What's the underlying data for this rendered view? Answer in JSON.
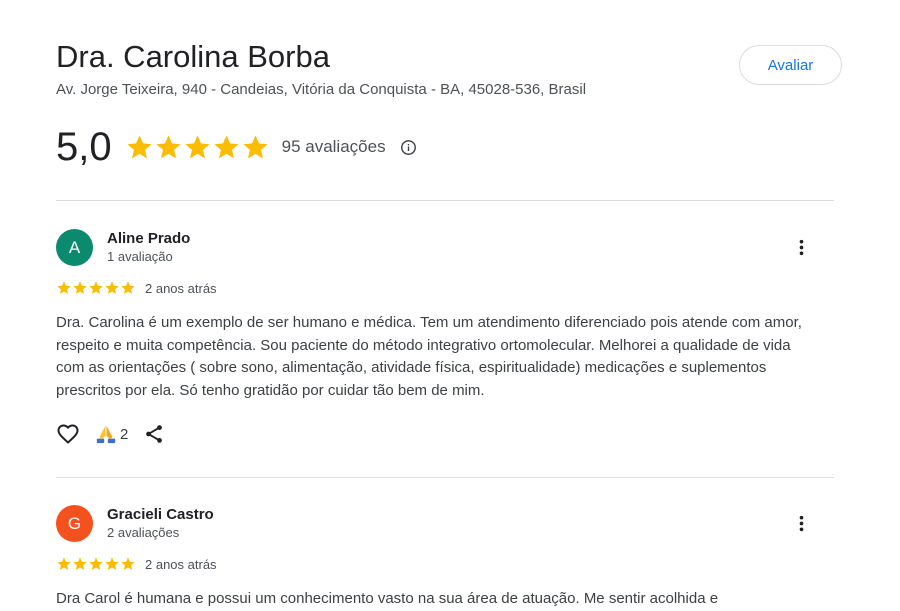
{
  "place": {
    "name": "Dra. Carolina Borba",
    "address": "Av. Jorge Teixeira, 940 - Candeias, Vitória da Conquista - BA, 45028-536, Brasil",
    "rate_button_label": "Avaliar"
  },
  "summary": {
    "rating": "5,0",
    "stars": 5,
    "reviews_count": "95 avaliações"
  },
  "colors": {
    "star": "#fbbc04",
    "accent": "#1a73e8"
  },
  "reviews": [
    {
      "avatar_letter": "A",
      "avatar_color": "#0b8a6d",
      "name": "Aline Prado",
      "subtitle": "1 avaliação",
      "stars": 5,
      "time": "2 anos atrás",
      "text": "Dra. Carolina é um exemplo de ser humano e médica. Tem um atendimento diferenciado pois atende com amor, respeito e muita competência. Sou paciente do método integrativo ortomolecular. Melhorei a qualidade de vida com as orientações ( sobre sono, alimentação, atividade física, espiritualidade) medicações e suplementos prescritos por ela. Só tenho gratidão por cuidar tão bem de mim.",
      "reaction_count": "2"
    },
    {
      "avatar_letter": "G",
      "avatar_color": "#f4511e",
      "name": "Gracieli Castro",
      "subtitle": "2 avaliações",
      "stars": 5,
      "time": "2 anos atrás",
      "text": "Dra Carol é humana e possui um conhecimento vasto na sua área de atuação. Me sentir acolhida e"
    }
  ]
}
